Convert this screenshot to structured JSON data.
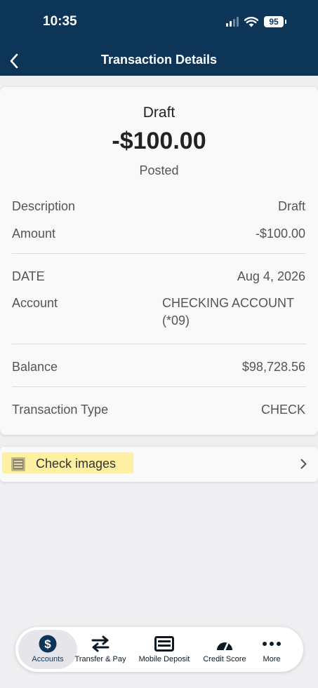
{
  "status_bar": {
    "time": "10:35",
    "battery": "95"
  },
  "nav": {
    "title": "Transaction Details"
  },
  "summary": {
    "name": "Draft",
    "amount": "-$100.00",
    "status": "Posted"
  },
  "details": {
    "description_label": "Description",
    "description_value": "Draft",
    "amount_label": "Amount",
    "amount_value": "-$100.00",
    "date_label": "DATE",
    "date_value": "Aug 4, 2026",
    "account_label": "Account",
    "account_value_line1": "CHECKING ACCOUNT",
    "account_value_line2": "(*09)",
    "balance_label": "Balance",
    "balance_value": "$98,728.56",
    "type_label": "Transaction Type",
    "type_value": "CHECK"
  },
  "check_images": {
    "label": "Check images"
  },
  "tabs": [
    {
      "label": "Accounts",
      "icon": "dollar-circle-icon",
      "active": true
    },
    {
      "label": "Transfer & Pay",
      "icon": "transfer-arrows-icon"
    },
    {
      "label": "Mobile Deposit",
      "icon": "check-card-icon"
    },
    {
      "label": "Credit Score",
      "icon": "gauge-icon"
    },
    {
      "label": "More",
      "icon": "more-dots-icon"
    }
  ],
  "colors": {
    "header": "#0d3557",
    "highlight": "#fdf0a0",
    "background": "#efeff2"
  }
}
